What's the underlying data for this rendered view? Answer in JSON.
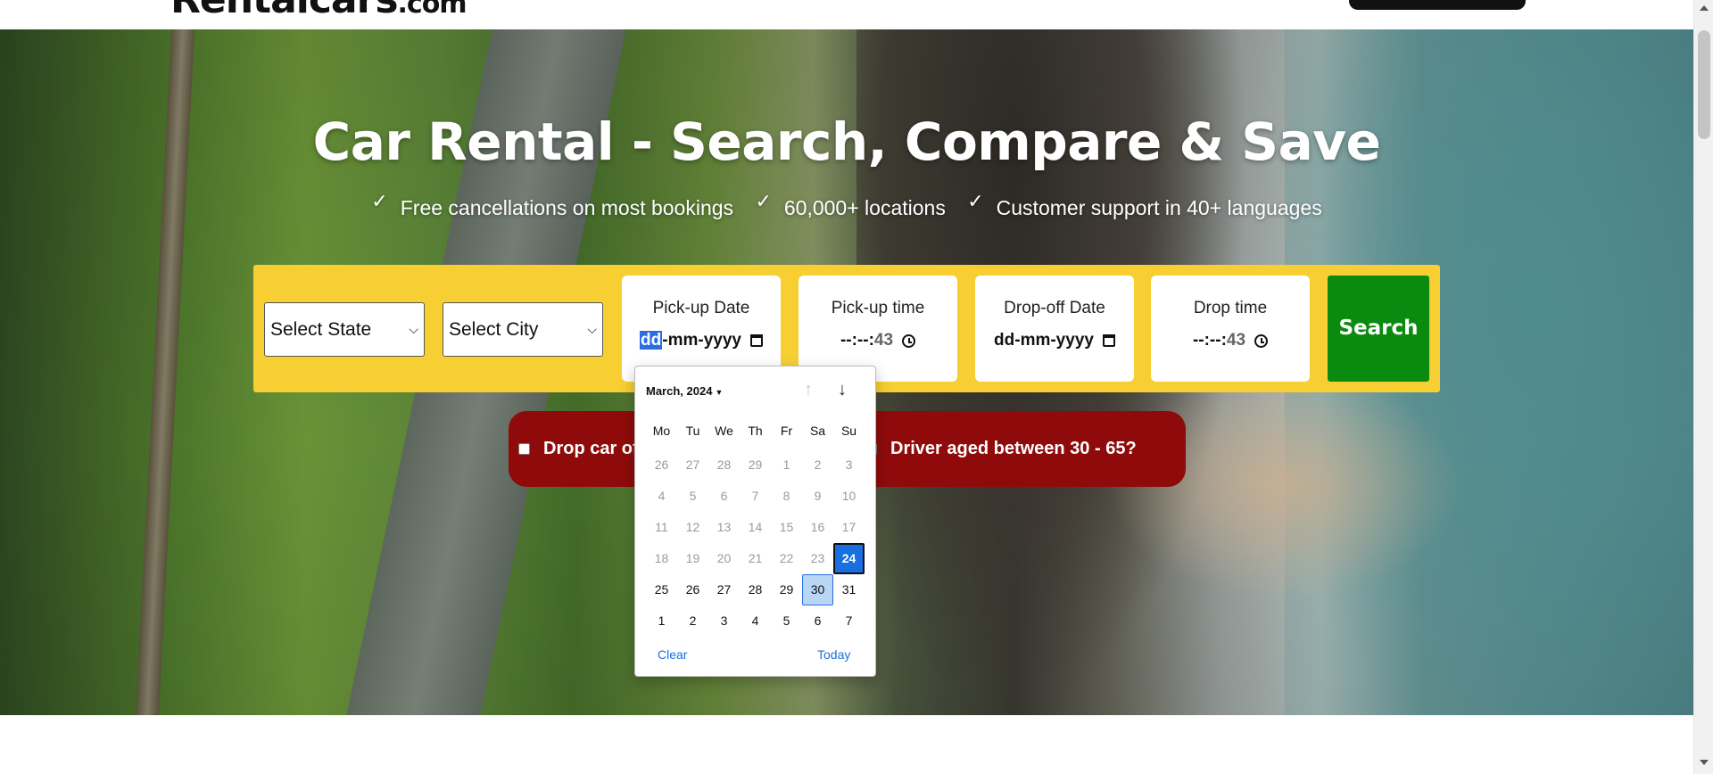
{
  "header": {
    "logo": "Rentalcars",
    "logo_domain": ".com"
  },
  "hero": {
    "title": "Car Rental - Search, Compare & Save",
    "features": [
      {
        "icon": "check-icon",
        "label": "Free cancellations on most bookings"
      },
      {
        "icon": "check-icon",
        "label": "60,000+ locations"
      },
      {
        "icon": "check-icon",
        "label": "Customer support in 40+ languages"
      }
    ]
  },
  "search": {
    "state_select": "Select State",
    "city_select": "Select City",
    "pickup_date": {
      "label": "Pick-up Date",
      "value_dd": "dd",
      "value_rest": "-mm-yyyy"
    },
    "pickup_time": {
      "label": "Pick-up time",
      "value_main": "--:--:",
      "value_sec": "43"
    },
    "dropoff_date": {
      "label": "Drop-off Date",
      "value": "dd-mm-yyyy"
    },
    "drop_time": {
      "label": "Drop time",
      "value_main": "--:--:",
      "value_sec": "43"
    },
    "button": "Search"
  },
  "options": {
    "drop_off_label": "Drop car off at different location",
    "driver_age_label": "Driver aged between 30 - 65?"
  },
  "datepicker": {
    "month_label": "March, 2024",
    "weekdays": [
      "Mo",
      "Tu",
      "We",
      "Th",
      "Fr",
      "Sa",
      "Su"
    ],
    "days": [
      {
        "d": "26",
        "s": "dim"
      },
      {
        "d": "27",
        "s": "dim"
      },
      {
        "d": "28",
        "s": "dim"
      },
      {
        "d": "29",
        "s": "dim"
      },
      {
        "d": "1",
        "s": "dim"
      },
      {
        "d": "2",
        "s": "dim"
      },
      {
        "d": "3",
        "s": "dim"
      },
      {
        "d": "4",
        "s": "dim"
      },
      {
        "d": "5",
        "s": "dim"
      },
      {
        "d": "6",
        "s": "dim"
      },
      {
        "d": "7",
        "s": "dim"
      },
      {
        "d": "8",
        "s": "dim"
      },
      {
        "d": "9",
        "s": "dim"
      },
      {
        "d": "10",
        "s": "dim"
      },
      {
        "d": "11",
        "s": "dim"
      },
      {
        "d": "12",
        "s": "dim"
      },
      {
        "d": "13",
        "s": "dim"
      },
      {
        "d": "14",
        "s": "dim"
      },
      {
        "d": "15",
        "s": "dim"
      },
      {
        "d": "16",
        "s": "dim"
      },
      {
        "d": "17",
        "s": "dim"
      },
      {
        "d": "18",
        "s": "dim"
      },
      {
        "d": "19",
        "s": "dim"
      },
      {
        "d": "20",
        "s": "dim"
      },
      {
        "d": "21",
        "s": "dim"
      },
      {
        "d": "22",
        "s": "dim"
      },
      {
        "d": "23",
        "s": "dim"
      },
      {
        "d": "24",
        "s": "today"
      },
      {
        "d": "25",
        "s": ""
      },
      {
        "d": "26",
        "s": ""
      },
      {
        "d": "27",
        "s": ""
      },
      {
        "d": "28",
        "s": ""
      },
      {
        "d": "29",
        "s": ""
      },
      {
        "d": "30",
        "s": "sel"
      },
      {
        "d": "31",
        "s": ""
      },
      {
        "d": "1",
        "s": ""
      },
      {
        "d": "2",
        "s": ""
      },
      {
        "d": "3",
        "s": ""
      },
      {
        "d": "4",
        "s": ""
      },
      {
        "d": "5",
        "s": ""
      },
      {
        "d": "6",
        "s": ""
      },
      {
        "d": "7",
        "s": ""
      }
    ],
    "clear_label": "Clear",
    "today_label": "Today"
  },
  "colors": {
    "search_panel": "#f7cf33",
    "search_button": "#0b8a10",
    "options_bar": "#8f0b0b",
    "datepicker_today": "#1a6fe0"
  }
}
